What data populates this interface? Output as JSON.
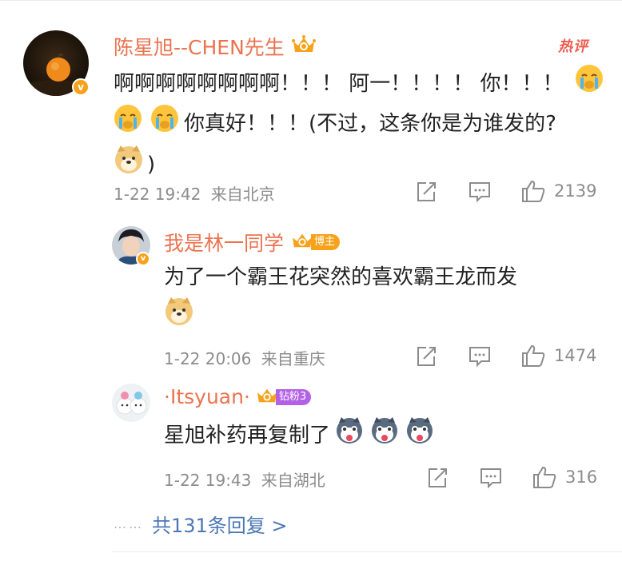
{
  "comment": {
    "username": "陈星旭--CHEN先生",
    "hot_label": "热评",
    "text_line1": "啊啊啊啊啊啊啊啊！！！ 阿一！！！！ 你！！！",
    "text_line2": "你真好！！！(不过，这条你是为谁发的?",
    "text_line3": ")",
    "date": "1-22 19:42",
    "location": "来自北京",
    "likes": "2139",
    "verified_badge": "v"
  },
  "replies": [
    {
      "username": "我是林一同学",
      "badge_text": "博主",
      "text": "为了一个霸王花突然的喜欢霸王龙而发",
      "date": "1-22 20:06",
      "location": "来自重庆",
      "likes": "1474",
      "verified_badge": "v"
    },
    {
      "username": "·Itsyuan·",
      "badge_text": "钻粉3",
      "text": "星旭补药再复制了",
      "date": "1-22 19:43",
      "location": "来自湖北",
      "likes": "316"
    }
  ],
  "more_replies": {
    "dots": "……",
    "label": "共131条回复 >"
  },
  "icons": {
    "share": "share-icon",
    "comment": "comment-icon",
    "like": "thumbs-up-icon",
    "cry_emoji": "crying-emoji-icon",
    "doge_emoji": "doge-emoji-icon",
    "husky_emoji": "husky-emoji-icon",
    "crown": "crown-icon"
  },
  "colors": {
    "username": "#eb7350",
    "link": "#4b77b4",
    "meta": "#8c8c8c",
    "hot": "#ee5b4f",
    "badge_orange": "#f7a21b",
    "badge_purple": "#b362e6"
  }
}
